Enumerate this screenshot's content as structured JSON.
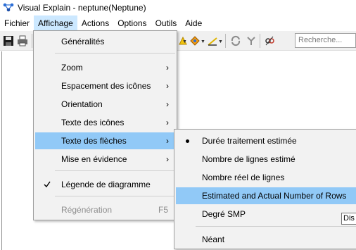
{
  "window": {
    "title": "Visual Explain - neptune(Neptune)"
  },
  "menubar": [
    "Fichier",
    "Affichage",
    "Actions",
    "Options",
    "Outils",
    "Aide"
  ],
  "toolbar": {
    "search_placeholder": "Recherche..."
  },
  "affichage_menu": {
    "items": [
      {
        "label": "Généralités"
      },
      {
        "label": "Zoom"
      },
      {
        "label": "Espacement des icônes"
      },
      {
        "label": "Orientation"
      },
      {
        "label": "Texte des icônes"
      },
      {
        "label": "Texte des flèches"
      },
      {
        "label": "Mise en évidence"
      },
      {
        "label": "Légende de diagramme",
        "checked": true
      },
      {
        "label": "Régénération",
        "shortcut": "F5",
        "disabled": true
      }
    ]
  },
  "fleches_submenu": {
    "items": [
      {
        "label": "Durée traitement estimée",
        "selected": true
      },
      {
        "label": "Nombre de lignes estimé"
      },
      {
        "label": "Nombre réel de lignes"
      },
      {
        "label": "Estimated and Actual Number of Rows"
      },
      {
        "label": "Degré SMP"
      },
      {
        "label": "Néant"
      }
    ]
  },
  "tooltip": {
    "text": "Dis"
  },
  "colors": {
    "highlight": "#91c9f7",
    "menubar_active": "#cce8ff",
    "menu_bg": "#f2f2f2",
    "disabled": "#8d8d8d"
  }
}
